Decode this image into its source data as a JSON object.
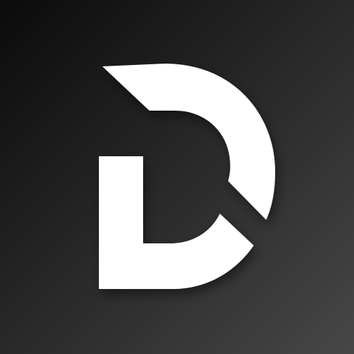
{
  "icon": {
    "name": "stylized-d-logo",
    "background_gradient_start": "#0b0b0b",
    "background_gradient_end": "#474747",
    "glyph_color": "#ffffff"
  }
}
